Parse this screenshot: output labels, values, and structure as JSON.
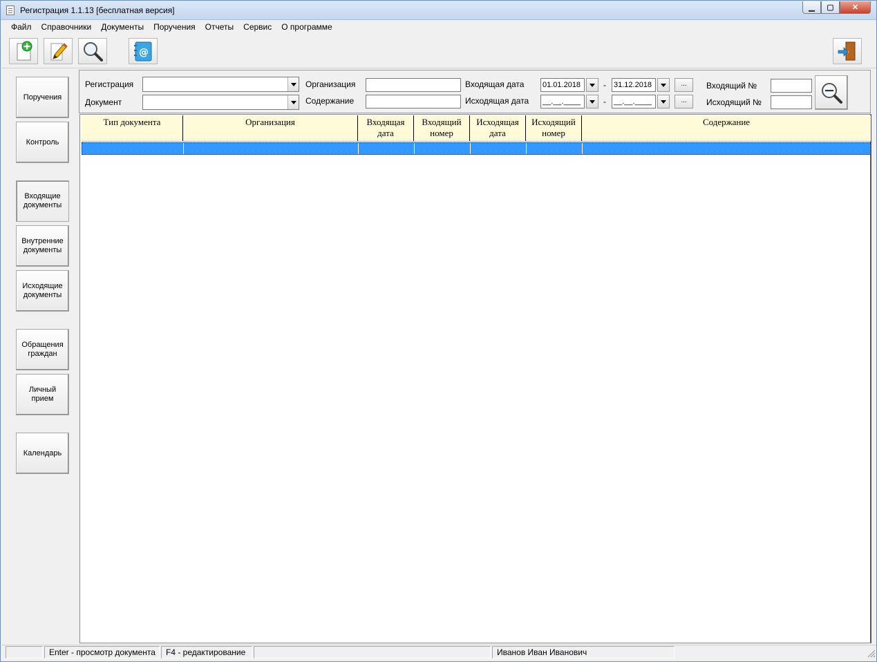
{
  "window": {
    "title": "Регистрация 1.1.13 [бесплатная версия]",
    "controls": {
      "minimize": "▁",
      "maximize": "▢",
      "close": "✕"
    }
  },
  "menu": [
    "Файл",
    "Справочники",
    "Документы",
    "Поручения",
    "Отчеты",
    "Сервис",
    "О программе"
  ],
  "toolbar": {
    "buttons": [
      {
        "icon": "new-document-icon"
      },
      {
        "icon": "edit-pencil-icon"
      },
      {
        "icon": "search-magnifier-icon"
      },
      {
        "icon": "email-notebook-icon"
      },
      {
        "icon": "exit-door-icon"
      }
    ]
  },
  "sidebar": {
    "buttons": [
      "Поручения",
      "Контроль",
      "Входящие документы",
      "Внутренние документы",
      "Исходящие документы",
      "Обращения граждан",
      "Личный прием",
      "Календарь"
    ]
  },
  "filter": {
    "registration_label": "Регистрация",
    "registration_value": "",
    "document_label": "Документ",
    "document_value": "",
    "organization_label": "Организация",
    "organization_value": "",
    "content_label": "Содержание",
    "content_value": "",
    "incoming_date_label": "Входящая дата",
    "incoming_date_from": "01.01.2018",
    "incoming_date_to": "31.12.2018",
    "outgoing_date_label": "Исходящая дата",
    "outgoing_date_from": "__.__.____",
    "outgoing_date_to": "__.__.____",
    "dash": "-",
    "dots_label": "...",
    "incoming_no_label": "Входящий №",
    "incoming_no_value": "",
    "outgoing_no_label": "Исходящий №",
    "outgoing_no_value": ""
  },
  "grid": {
    "columns": [
      "Тип документа",
      "Организация",
      "Входящая дата",
      "Входящий номер",
      "Исходящая дата",
      "Исходящий номер",
      "Содержание"
    ],
    "rows": [
      [
        "",
        "",
        "",
        "",
        "",
        "",
        ""
      ]
    ]
  },
  "status": {
    "panel1": "",
    "panel2": "Enter - просмотр документа",
    "panel3": "F4 - редактирование",
    "panel4": "",
    "panel5": "Иванов Иван Иванович"
  },
  "colors": {
    "header_bg": "#fffbd8",
    "selected_row": "#3399ff",
    "window_bg": "#f0f0f0"
  }
}
